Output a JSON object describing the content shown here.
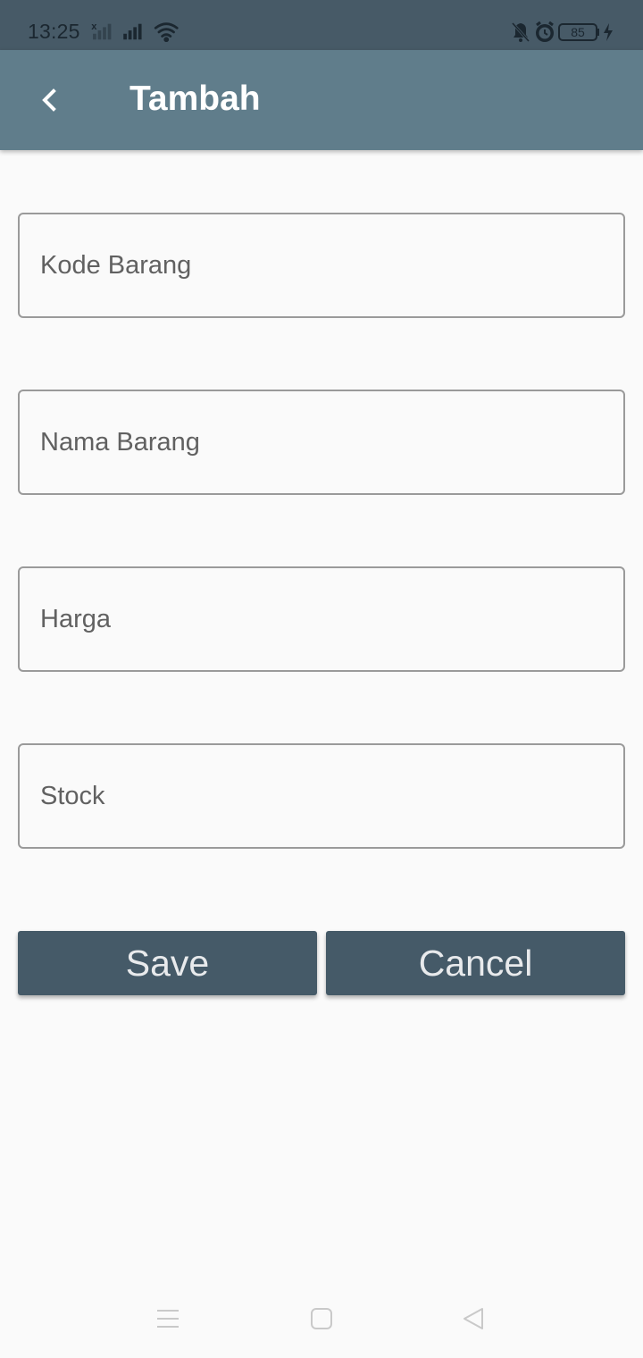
{
  "status_bar": {
    "time": "13:25",
    "battery": "85",
    "icons": [
      "signal-x-icon",
      "signal-icon",
      "wifi-icon",
      "bell-off-icon",
      "alarm-icon",
      "battery-icon",
      "charging-icon"
    ]
  },
  "app_bar": {
    "title": "Tambah",
    "back_icon": "chevron-left-icon"
  },
  "form": {
    "fields": [
      {
        "placeholder": "Kode Barang",
        "value": ""
      },
      {
        "placeholder": "Nama Barang",
        "value": ""
      },
      {
        "placeholder": "Harga",
        "value": ""
      },
      {
        "placeholder": "Stock",
        "value": ""
      }
    ],
    "save_label": "Save",
    "cancel_label": "Cancel"
  },
  "nav_bar": {
    "icons": [
      "menu-icon",
      "home-square-icon",
      "back-triangle-icon"
    ]
  },
  "colors": {
    "status_bar": "#475a67",
    "app_bar": "#607d8b",
    "button": "#455a68",
    "background": "#fafafa"
  }
}
